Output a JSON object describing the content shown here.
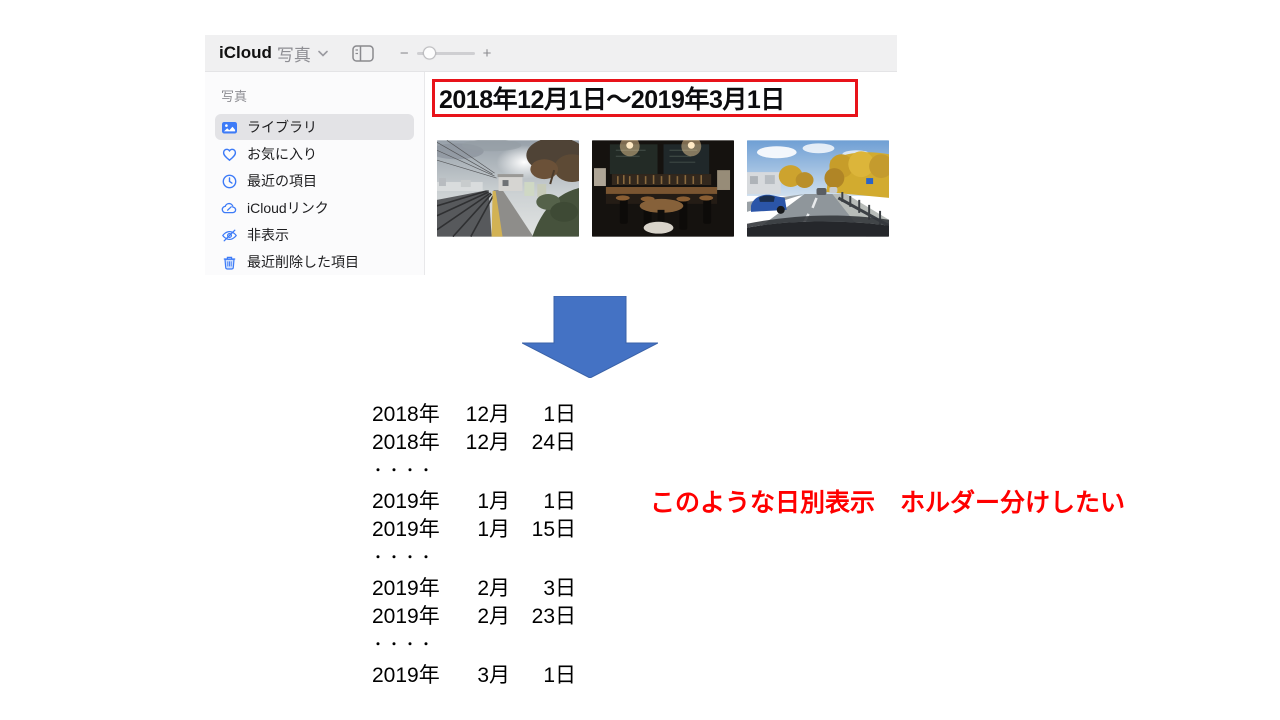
{
  "window": {
    "header": {
      "app_name": "iCloud",
      "section": "写真"
    },
    "toolbar": {
      "zoom_out_label": "−",
      "zoom_in_label": "+"
    },
    "sidebar": {
      "section_label": "写真",
      "items": [
        {
          "label": "ライブラリ",
          "icon": "photos-library-icon",
          "selected": true
        },
        {
          "label": "お気に入り",
          "icon": "heart-icon",
          "selected": false
        },
        {
          "label": "最近の項目",
          "icon": "clock-icon",
          "selected": false
        },
        {
          "label": "iCloudリンク",
          "icon": "cloud-link-icon",
          "selected": false
        },
        {
          "label": "非表示",
          "icon": "eye-slash-icon",
          "selected": false
        },
        {
          "label": "最近削除した項目",
          "icon": "trash-icon",
          "selected": false
        }
      ]
    },
    "main": {
      "date_range_title": "2018年12月1日～2019年3月1日",
      "photos": [
        {
          "alt": "駅のホームと線路、秋の木々の写真"
        },
        {
          "alt": "薄暗いバーのカウンターとスツールの写真"
        },
        {
          "alt": "車内から見た黄葉の並木道の写真"
        }
      ]
    }
  },
  "annotation": {
    "dates": {
      "rows": [
        {
          "year": "2018年",
          "month": "12月",
          "day": "1日"
        },
        {
          "year": "2018年",
          "month": "12月",
          "day": "24日"
        },
        {
          "dots": "・・・・"
        },
        {
          "year": "2019年",
          "month": "1月",
          "day": "1日"
        },
        {
          "year": "2019年",
          "month": "1月",
          "day": "15日"
        },
        {
          "dots": "・・・・"
        },
        {
          "year": "2019年",
          "month": "2月",
          "day": "3日"
        },
        {
          "year": "2019年",
          "month": "2月",
          "day": "23日"
        },
        {
          "dots": "・・・・"
        },
        {
          "year": "2019年",
          "month": "3月",
          "day": "1日"
        }
      ]
    },
    "note_text": "このような日別表示　ホルダー分けしたい",
    "colors": {
      "note_red": "#ff0000",
      "highlight_box_red": "#e8131a",
      "arrow_blue": "#4472c4",
      "icon_blue": "#3d7bf7"
    }
  }
}
